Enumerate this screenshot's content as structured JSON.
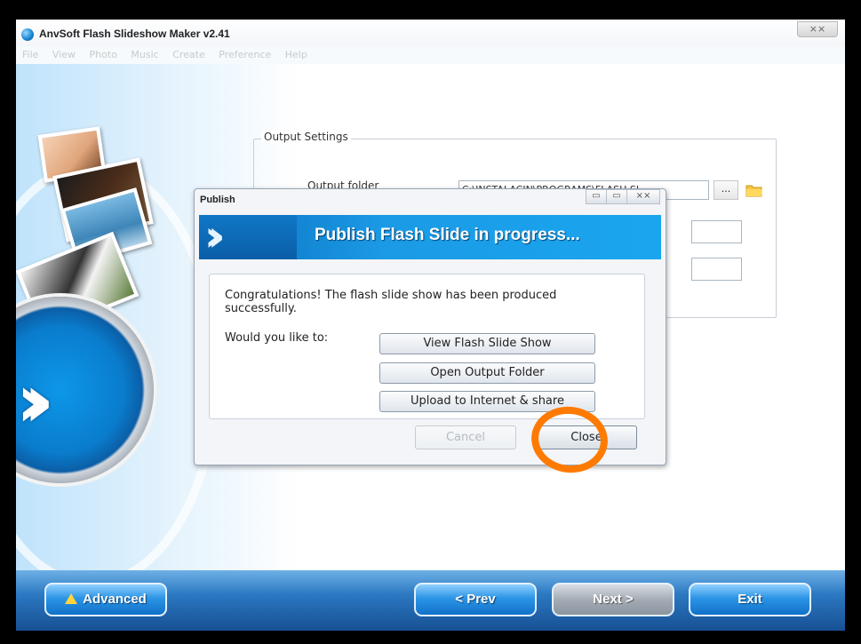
{
  "app": {
    "title": "AnvSoft Flash Slideshow Maker v2.41",
    "close_glyph": "⨯⨯"
  },
  "menu": {
    "items": [
      "File",
      "View",
      "Photo",
      "Music",
      "Create",
      "Preference",
      "Help"
    ]
  },
  "output_settings": {
    "title": "Output Settings",
    "folder_label": "Output folder",
    "folder_value": "C:\\INSTALACIN\\PROGRAMS\\FLASH SL",
    "browse_label": "..."
  },
  "dialog": {
    "title": "Publish",
    "banner_text": "Publish Flash Slide in progress...",
    "message": "Congratulations! The flash slide show has been produced successfully.",
    "question": "Would you like to:",
    "options": [
      "View Flash Slide Show",
      "Open Output Folder",
      "Upload to Internet & share"
    ],
    "cancel_label": "Cancel",
    "close_label": "Close",
    "controls": [
      "▭",
      "▭",
      "⨯⨯"
    ]
  },
  "bottom": {
    "advanced_label": "Advanced",
    "prev_label": "< Prev",
    "next_label": "Next >",
    "exit_label": "Exit"
  },
  "colors": {
    "highlight": "#ff7a00",
    "accent": "#1a9ae5"
  }
}
